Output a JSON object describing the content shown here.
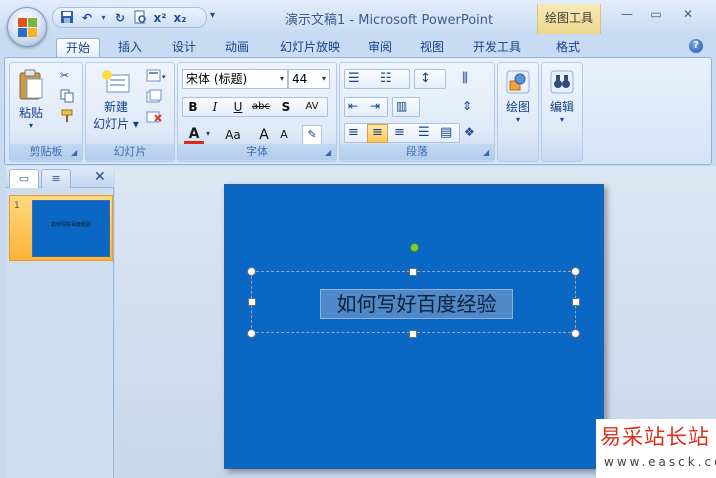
{
  "window": {
    "title": "演示文稿1 - Microsoft PowerPoint",
    "contextual_tab": "绘图工具",
    "buttons": {
      "minimize": "—",
      "maximize": "▭",
      "close": "✕"
    }
  },
  "quick_access": {
    "icons": [
      "save-icon",
      "undo-icon",
      "redo-icon",
      "print-preview-icon",
      "superscript-icon",
      "subscript-icon"
    ],
    "superscript": "x²",
    "subscript": "x₂",
    "more": "▾"
  },
  "tabs": [
    {
      "label": "开始",
      "active": true
    },
    {
      "label": "插入"
    },
    {
      "label": "设计"
    },
    {
      "label": "动画"
    },
    {
      "label": "幻灯片放映"
    },
    {
      "label": "审阅"
    },
    {
      "label": "视图"
    },
    {
      "label": "开发工具"
    },
    {
      "label": "格式"
    }
  ],
  "help": "?",
  "ribbon": {
    "clipboard": {
      "label": "剪贴板",
      "paste": "粘贴"
    },
    "slides": {
      "label": "幻灯片",
      "new_slide_line1": "新建",
      "new_slide_line2": "幻灯片"
    },
    "font": {
      "label": "字体",
      "family": "宋体 (标题)",
      "size": "44",
      "bold": "B",
      "italic": "I",
      "underline": "U",
      "strike": "abc",
      "shadow": "S",
      "spacing": "AV",
      "color": "A",
      "change_case": "Aa",
      "grow": "A",
      "shrink": "A"
    },
    "paragraph": {
      "label": "段落"
    },
    "drawing": {
      "label": "绘图"
    },
    "editing": {
      "label": "编辑"
    }
  },
  "slide_pane": {
    "tab_slides": "▭",
    "tab_outline": "≡",
    "close": "✕",
    "thumb_number": "1",
    "thumb_text": "如何写好百度经验"
  },
  "slide": {
    "title_text": "如何写好百度经验",
    "background": "#0a67c4"
  },
  "watermark": {
    "line1": "易采站长站",
    "line2": "www.easck.com"
  }
}
